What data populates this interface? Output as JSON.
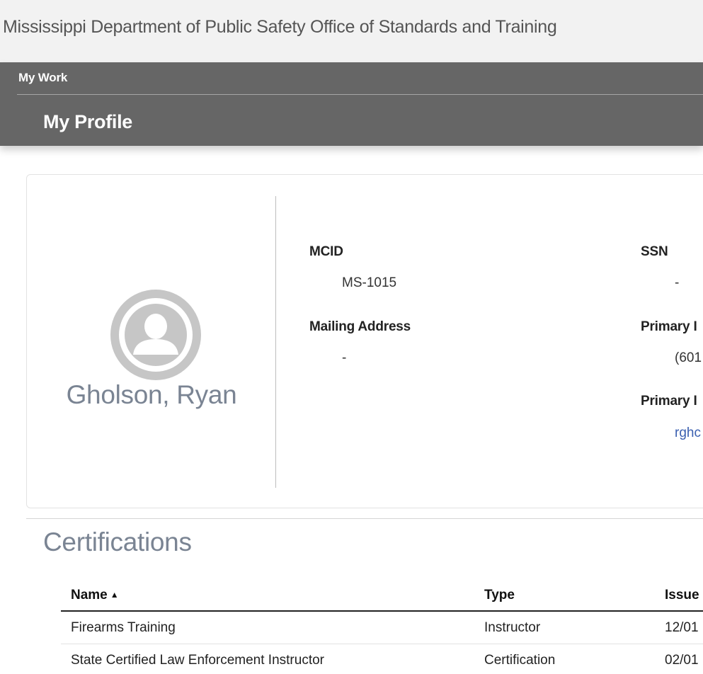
{
  "site": {
    "title": "Mississippi Department of Public Safety Office of Standards and Training"
  },
  "page_bar": {
    "breadcrumb": "My Work",
    "title": "My Profile"
  },
  "profile": {
    "avatar_icon": "user-avatar-icon",
    "name": "Gholson, Ryan",
    "fields": {
      "mcid": {
        "label": "MCID",
        "value": "MS-1015"
      },
      "ssn": {
        "label": "SSN",
        "value": "-"
      },
      "mailing_address": {
        "label": "Mailing Address",
        "value": "-"
      },
      "primary_phone": {
        "label": "Primary I",
        "value": "(601"
      },
      "primary_email": {
        "label": "Primary I",
        "value": "rghc"
      }
    }
  },
  "certifications": {
    "title": "Certifications",
    "columns": {
      "name": "Name",
      "sort_indicator": "▲",
      "type": "Type",
      "issue": "Issue"
    },
    "rows": [
      {
        "name": "Firearms Training",
        "type": "Instructor",
        "issue": "12/01"
      },
      {
        "name": "State Certified Law Enforcement Instructor",
        "type": "Certification",
        "issue": "02/01"
      }
    ]
  },
  "colors": {
    "header_bg": "#f2f2f2",
    "page_bar_bg": "#666666",
    "accent_gray_text": "#7a8493",
    "link": "#3a5fb0"
  }
}
